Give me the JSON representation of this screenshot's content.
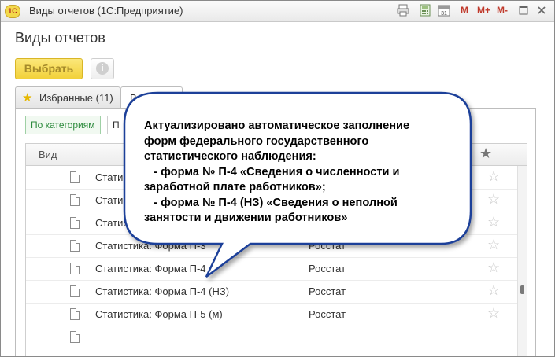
{
  "window": {
    "logo_text": "1С",
    "title": "Виды отчетов  (1С:Предприятие)",
    "toolbar_buttons": [
      "М",
      "М+",
      "М-"
    ],
    "icons": [
      "print-icon",
      "calculator-icon",
      "calendar-icon",
      "info-icon",
      "maximize-icon",
      "close-icon"
    ]
  },
  "form": {
    "title": "Виды отчетов",
    "select_label": "Выбрать",
    "info_glyph": "i"
  },
  "tabs": [
    {
      "label": "Избранные (11)",
      "icon": "star-icon"
    },
    {
      "label": "Все (3"
    }
  ],
  "subtabs": [
    {
      "label": "По категориям"
    },
    {
      "label": "П"
    }
  ],
  "grid": {
    "header": {
      "vid": "Вид",
      "fav_icon": "★"
    },
    "rows": [
      {
        "name": "Статисти",
        "source": "",
        "fav": "☆"
      },
      {
        "name": "Статисти",
        "source": "",
        "fav": "☆"
      },
      {
        "name": "Статисти",
        "source": "",
        "fav": "☆"
      },
      {
        "name": "Статистика: Форма П-3",
        "source": "Росстат",
        "fav": "☆"
      },
      {
        "name": "Статистика: Форма П-4",
        "source": "Росстат",
        "fav": "☆"
      },
      {
        "name": "Статистика: Форма П-4 (НЗ)",
        "source": "Росстат",
        "fav": "☆"
      },
      {
        "name": "Статистика: Форма П-5 (м)",
        "source": "Росстат",
        "fav": "☆"
      }
    ]
  },
  "callout": {
    "lines": [
      "Актуализировано автоматическое заполнение",
      "форм федерального государственного",
      "статистического наблюдения:",
      "   - форма № П-4 «Сведения о численности и",
      "заработной плате работников»;",
      "   - форма № П-4 (НЗ) «Сведения о неполной",
      "занятости и движении работников»"
    ],
    "fill": "#ffffff",
    "stroke": "#1c3f99"
  }
}
